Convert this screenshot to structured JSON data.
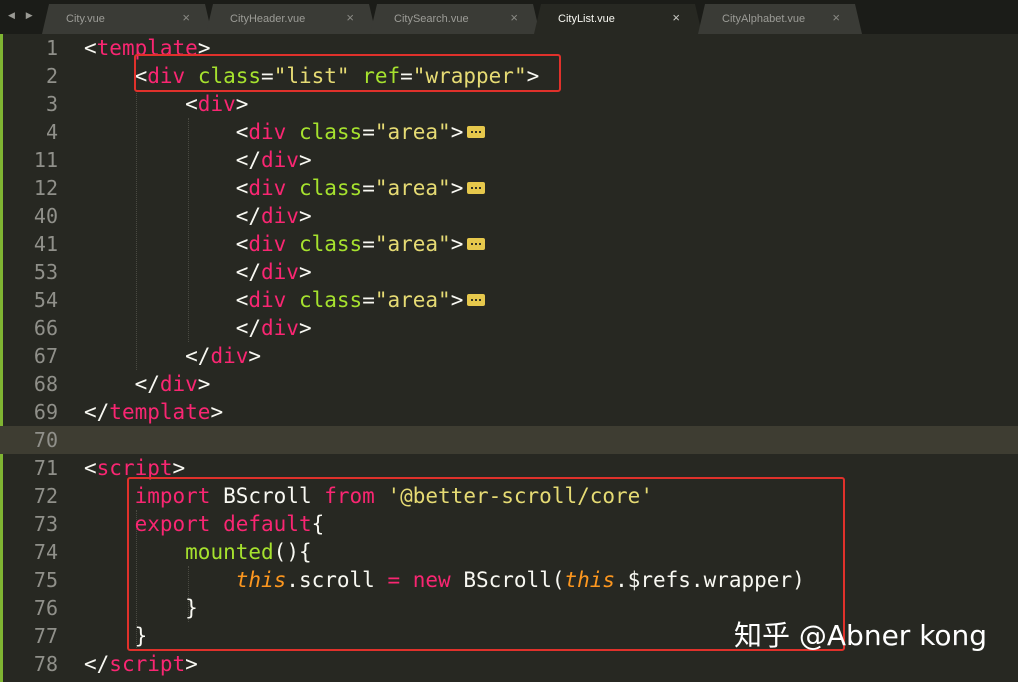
{
  "tabs": [
    {
      "title": "City.vue",
      "active": false
    },
    {
      "title": "CityHeader.vue",
      "active": false
    },
    {
      "title": "CitySearch.vue",
      "active": false
    },
    {
      "title": "CityList.vue",
      "active": true
    },
    {
      "title": "CityAlphabet.vue",
      "active": false
    }
  ],
  "close_glyph": "×",
  "nav_glyph": "◀ ▶",
  "current_line": "70",
  "lines": [
    {
      "n": "1",
      "t": [
        [
          "t-p",
          "<"
        ],
        [
          "t-tag",
          "template"
        ],
        [
          "t-p",
          ">"
        ]
      ]
    },
    {
      "n": "2",
      "t": [
        [
          "t-p",
          "    <"
        ],
        [
          "t-tag",
          "div"
        ],
        [
          "t-p",
          " "
        ],
        [
          "t-atr",
          "class"
        ],
        [
          "t-p",
          "="
        ],
        [
          "t-str",
          "\"list\""
        ],
        [
          "t-p",
          " "
        ],
        [
          "t-atr",
          "ref"
        ],
        [
          "t-p",
          "="
        ],
        [
          "t-str",
          "\"wrapper\""
        ],
        [
          "t-p",
          ">"
        ]
      ]
    },
    {
      "n": "3",
      "t": [
        [
          "t-p",
          "        <"
        ],
        [
          "t-tag",
          "div"
        ],
        [
          "t-p",
          ">"
        ]
      ]
    },
    {
      "n": "4",
      "t": [
        [
          "t-p",
          "            <"
        ],
        [
          "t-tag",
          "div"
        ],
        [
          "t-p",
          " "
        ],
        [
          "t-atr",
          "class"
        ],
        [
          "t-p",
          "="
        ],
        [
          "t-str",
          "\"area\""
        ],
        [
          "t-p",
          ">"
        ]
      ],
      "fold": true
    },
    {
      "n": "11",
      "t": [
        [
          "t-p",
          "            </"
        ],
        [
          "t-tag",
          "div"
        ],
        [
          "t-p",
          ">"
        ]
      ]
    },
    {
      "n": "12",
      "t": [
        [
          "t-p",
          "            <"
        ],
        [
          "t-tag",
          "div"
        ],
        [
          "t-p",
          " "
        ],
        [
          "t-atr",
          "class"
        ],
        [
          "t-p",
          "="
        ],
        [
          "t-str",
          "\"area\""
        ],
        [
          "t-p",
          ">"
        ]
      ],
      "fold": true
    },
    {
      "n": "40",
      "t": [
        [
          "t-p",
          "            </"
        ],
        [
          "t-tag",
          "div"
        ],
        [
          "t-p",
          ">"
        ]
      ]
    },
    {
      "n": "41",
      "t": [
        [
          "t-p",
          "            <"
        ],
        [
          "t-tag",
          "div"
        ],
        [
          "t-p",
          " "
        ],
        [
          "t-atr",
          "class"
        ],
        [
          "t-p",
          "="
        ],
        [
          "t-str",
          "\"area\""
        ],
        [
          "t-p",
          ">"
        ]
      ],
      "fold": true
    },
    {
      "n": "53",
      "t": [
        [
          "t-p",
          "            </"
        ],
        [
          "t-tag",
          "div"
        ],
        [
          "t-p",
          ">"
        ]
      ]
    },
    {
      "n": "54",
      "t": [
        [
          "t-p",
          "            <"
        ],
        [
          "t-tag",
          "div"
        ],
        [
          "t-p",
          " "
        ],
        [
          "t-atr",
          "class"
        ],
        [
          "t-p",
          "="
        ],
        [
          "t-str",
          "\"area\""
        ],
        [
          "t-p",
          ">"
        ]
      ],
      "fold": true
    },
    {
      "n": "66",
      "t": [
        [
          "t-p",
          "            </"
        ],
        [
          "t-tag",
          "div"
        ],
        [
          "t-p",
          ">"
        ]
      ]
    },
    {
      "n": "67",
      "t": [
        [
          "t-p",
          "        </"
        ],
        [
          "t-tag",
          "div"
        ],
        [
          "t-p",
          ">"
        ]
      ]
    },
    {
      "n": "68",
      "t": [
        [
          "t-p",
          "    </"
        ],
        [
          "t-tag",
          "div"
        ],
        [
          "t-p",
          ">"
        ]
      ]
    },
    {
      "n": "69",
      "t": [
        [
          "t-p",
          "</"
        ],
        [
          "t-tag",
          "template"
        ],
        [
          "t-p",
          ">"
        ]
      ]
    },
    {
      "n": "70",
      "t": []
    },
    {
      "n": "71",
      "t": [
        [
          "t-p",
          "<"
        ],
        [
          "t-tag",
          "script"
        ],
        [
          "t-p",
          ">"
        ]
      ]
    },
    {
      "n": "72",
      "t": [
        [
          "t-p",
          "    "
        ],
        [
          "t-kw",
          "import"
        ],
        [
          "t-p",
          " BScroll "
        ],
        [
          "t-kw",
          "from"
        ],
        [
          "t-p",
          " "
        ],
        [
          "t-str",
          "'@better-scroll/core'"
        ]
      ]
    },
    {
      "n": "73",
      "t": [
        [
          "t-p",
          "    "
        ],
        [
          "t-kw",
          "export"
        ],
        [
          "t-p",
          " "
        ],
        [
          "t-kw",
          "default"
        ],
        [
          "t-p",
          "{"
        ]
      ]
    },
    {
      "n": "74",
      "t": [
        [
          "t-p",
          "        "
        ],
        [
          "t-fn",
          "mounted"
        ],
        [
          "t-p",
          "(){"
        ]
      ]
    },
    {
      "n": "75",
      "t": [
        [
          "t-p",
          "            "
        ],
        [
          "t-this",
          "this"
        ],
        [
          "t-p",
          ".scroll "
        ],
        [
          "t-kw",
          "="
        ],
        [
          "t-p",
          " "
        ],
        [
          "t-kw",
          "new"
        ],
        [
          "t-p",
          " BScroll("
        ],
        [
          "t-this",
          "this"
        ],
        [
          "t-p",
          ".$refs.wrapper)"
        ]
      ]
    },
    {
      "n": "76",
      "t": [
        [
          "t-p",
          "        }"
        ]
      ]
    },
    {
      "n": "77",
      "t": [
        [
          "t-p",
          "    }"
        ]
      ]
    },
    {
      "n": "78",
      "t": [
        [
          "t-p",
          "</"
        ],
        [
          "t-tag",
          "script"
        ],
        [
          "t-p",
          ">"
        ]
      ]
    }
  ],
  "watermark": "知乎 @Abner kong"
}
